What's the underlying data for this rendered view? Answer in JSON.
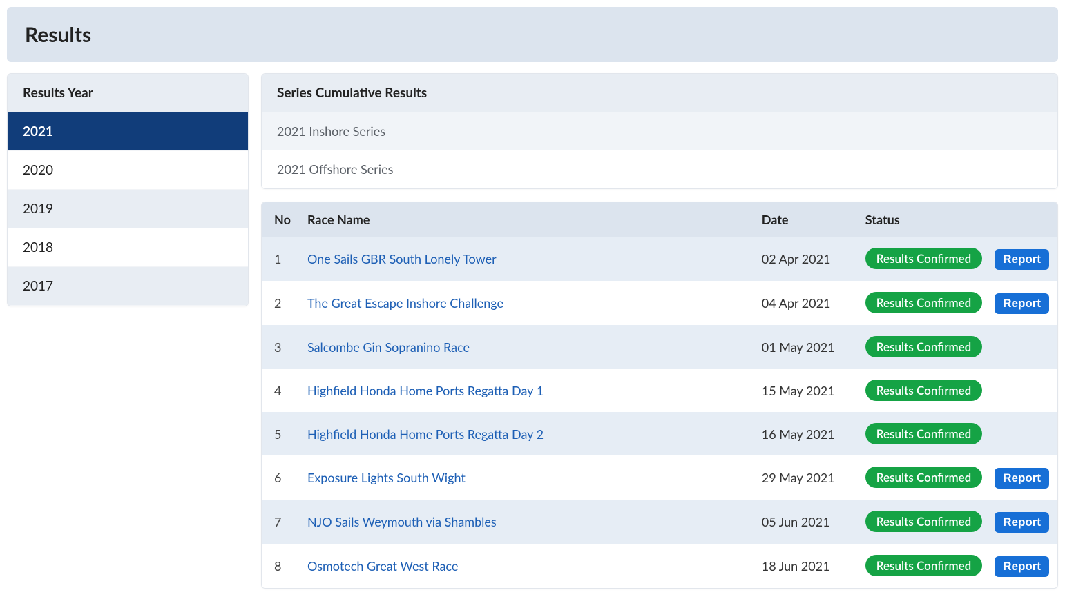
{
  "header": {
    "title": "Results"
  },
  "sidebar": {
    "title": "Results Year",
    "years": [
      {
        "label": "2021",
        "active": true
      },
      {
        "label": "2020",
        "active": false
      },
      {
        "label": "2019",
        "active": false
      },
      {
        "label": "2018",
        "active": false
      },
      {
        "label": "2017",
        "active": false
      }
    ]
  },
  "series_panel": {
    "title": "Series Cumulative Results",
    "items": [
      {
        "label": "2021 Inshore Series"
      },
      {
        "label": "2021 Offshore Series"
      }
    ]
  },
  "table": {
    "headers": {
      "no": "No",
      "name": "Race Name",
      "date": "Date",
      "status": "Status"
    },
    "status_label": "Results Confirmed",
    "report_label": "Report",
    "rows": [
      {
        "no": "1",
        "name": "One Sails GBR South Lonely Tower",
        "date": "02 Apr 2021",
        "report": true
      },
      {
        "no": "2",
        "name": "The Great Escape Inshore Challenge",
        "date": "04 Apr 2021",
        "report": true
      },
      {
        "no": "3",
        "name": "Salcombe Gin Sopranino Race",
        "date": "01 May 2021",
        "report": false
      },
      {
        "no": "4",
        "name": "Highfield Honda Home Ports Regatta Day 1",
        "date": "15 May 2021",
        "report": false
      },
      {
        "no": "5",
        "name": "Highfield Honda Home Ports Regatta Day 2",
        "date": "16 May 2021",
        "report": false
      },
      {
        "no": "6",
        "name": "Exposure Lights South Wight",
        "date": "29 May 2021",
        "report": true
      },
      {
        "no": "7",
        "name": "NJO Sails Weymouth via Shambles",
        "date": "05 Jun 2021",
        "report": true
      },
      {
        "no": "8",
        "name": "Osmotech Great West Race",
        "date": "18 Jun 2021",
        "report": true
      }
    ]
  }
}
